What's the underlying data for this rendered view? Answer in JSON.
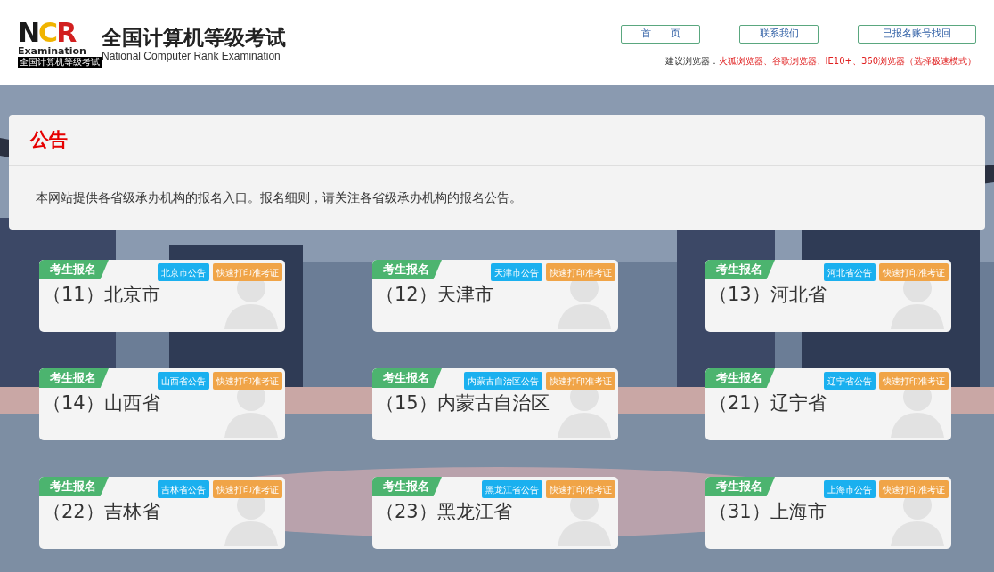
{
  "header": {
    "logo": {
      "letters": [
        {
          "text": "N",
          "color": "#1a1a1a"
        },
        {
          "text": "C",
          "color": "#f0b400"
        },
        {
          "text": "R",
          "color": "#d21f1f"
        }
      ],
      "word": "Examination",
      "strip": "全国计算机等级考试"
    },
    "title": "全国计算机等级考试",
    "subtitle": "National Computer Rank Examination",
    "nav": [
      "首　　页",
      "联系我们",
      "已报名账号找回"
    ],
    "browser_hint": {
      "label": "建议浏览器：",
      "value": "火狐浏览器、谷歌浏览器、IE10+、360浏览器（选择极速模式）"
    }
  },
  "notice": {
    "title": "公告",
    "text": "本网站提供各省级承办机构的报名入口。报名细则，请关注各省级承办机构的报名公告。"
  },
  "provinces": [
    {
      "tag": "考生报名",
      "notice": "北京市公告",
      "print": "快速打印准考证",
      "name": "（11）北京市"
    },
    {
      "tag": "考生报名",
      "notice": "天津市公告",
      "print": "快速打印准考证",
      "name": "（12）天津市"
    },
    {
      "tag": "考生报名",
      "notice": "河北省公告",
      "print": "快速打印准考证",
      "name": "（13）河北省"
    },
    {
      "tag": "考生报名",
      "notice": "山西省公告",
      "print": "快速打印准考证",
      "name": "（14）山西省"
    },
    {
      "tag": "考生报名",
      "notice": "内蒙古自治区公告",
      "print": "快速打印准考证",
      "name": "（15）内蒙古自治区"
    },
    {
      "tag": "考生报名",
      "notice": "辽宁省公告",
      "print": "快速打印准考证",
      "name": "（21）辽宁省"
    },
    {
      "tag": "考生报名",
      "notice": "吉林省公告",
      "print": "快速打印准考证",
      "name": "（22）吉林省"
    },
    {
      "tag": "考生报名",
      "notice": "黑龙江省公告",
      "print": "快速打印准考证",
      "name": "（23）黑龙江省"
    },
    {
      "tag": "考生报名",
      "notice": "上海市公告",
      "print": "快速打印准考证",
      "name": "（31）上海市"
    }
  ]
}
